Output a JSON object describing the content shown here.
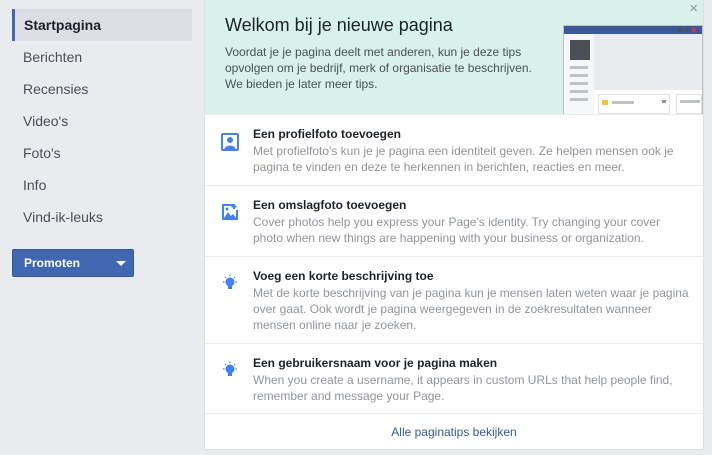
{
  "sidebar": {
    "items": [
      {
        "label": "Startpagina",
        "active": true
      },
      {
        "label": "Berichten"
      },
      {
        "label": "Recensies"
      },
      {
        "label": "Video's"
      },
      {
        "label": "Foto's"
      },
      {
        "label": "Info"
      },
      {
        "label": "Vind-ik-leuks"
      }
    ],
    "promote_label": "Promoten"
  },
  "welcome": {
    "title": "Welkom bij je nieuwe pagina",
    "text": "Voordat je je pagina deelt met anderen, kun je deze tips opvolgen om je bedrijf, merk of organisatie te beschrijven. We bieden je later meer tips.",
    "close_label": "×"
  },
  "tips": [
    {
      "icon": "profile-photo-icon",
      "title": "Een profielfoto toevoegen",
      "text": "Met profielfoto's kun je je pagina een identiteit geven. Ze helpen mensen ook je pagina te vinden en deze te herkennen in berichten, reacties en meer."
    },
    {
      "icon": "cover-photo-icon",
      "title": "Een omslagfoto toevoegen",
      "text": "Cover photos help you express your Page's identity. Try changing your cover photo when new things are happening with your business or organization."
    },
    {
      "icon": "lightbulb-icon",
      "title": "Voeg een korte beschrijving toe",
      "text": "Met de korte beschrijving van je pagina kun je mensen laten weten waar je pagina over gaat. Ook wordt je pagina weergegeven in de zoekresultaten wanneer mensen online naar je zoeken."
    },
    {
      "icon": "lightbulb-icon",
      "title": "Een gebruikersnaam voor je pagina maken",
      "text": "When you create a username, it appears in custom URLs that help people find, remember and message your Page."
    }
  ],
  "footer": {
    "link_label": "Alle paginatips bekijken"
  },
  "colors": {
    "accent": "#4267b2",
    "welcome_bg": "#d8f1ea",
    "icon_blue": "#4080ff"
  }
}
